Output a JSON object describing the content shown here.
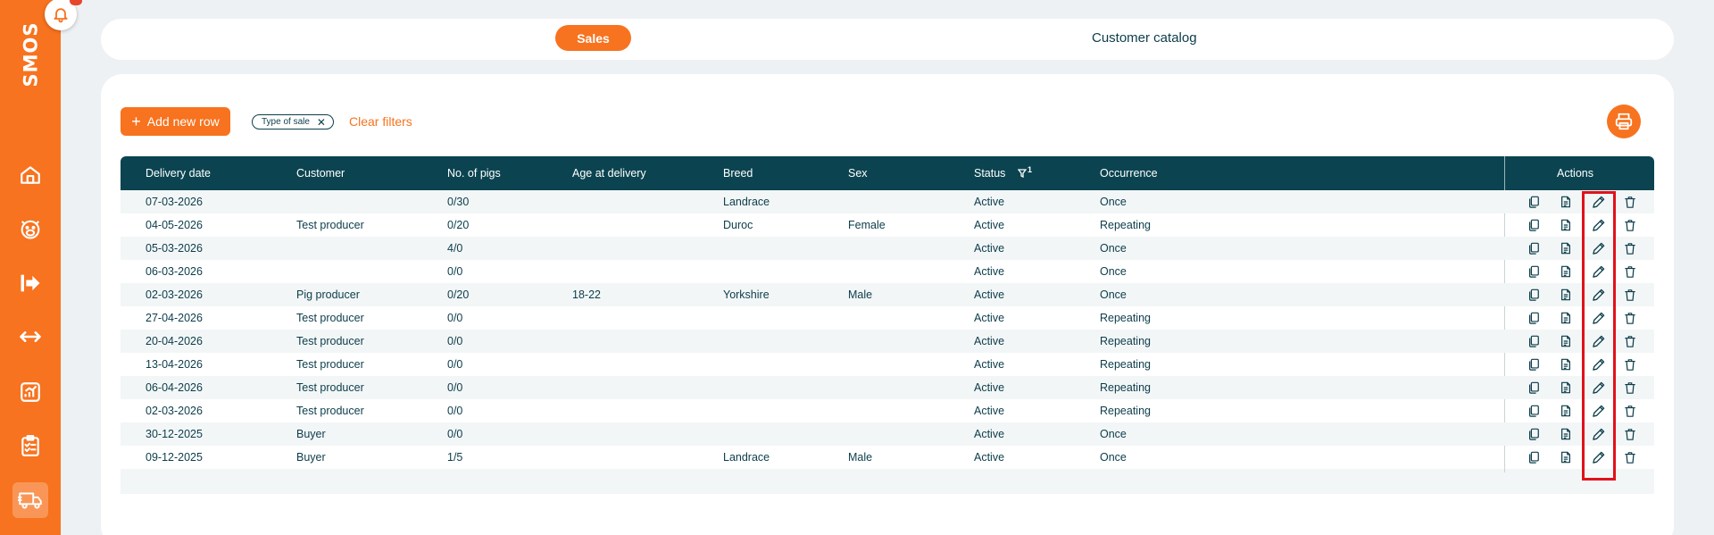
{
  "sidebar": {
    "brand": "SMOS",
    "items": [
      {
        "name": "home-icon"
      },
      {
        "name": "pig-icon"
      },
      {
        "name": "arrow-right-icon"
      },
      {
        "name": "exchange-icon"
      },
      {
        "name": "chart-icon"
      },
      {
        "name": "checklist-icon"
      },
      {
        "name": "truck-icon",
        "active": true
      }
    ]
  },
  "tabs": {
    "sales": "Sales",
    "catalog": "Customer catalog"
  },
  "toolbar": {
    "add_label": "Add new row",
    "filter_chip": "Type of sale",
    "clear_label": "Clear filters"
  },
  "table": {
    "headers": {
      "delivery_date": "Delivery date",
      "customer": "Customer",
      "pigs": "No. of pigs",
      "age": "Age at delivery",
      "breed": "Breed",
      "sex": "Sex",
      "status": "Status",
      "occurrence": "Occurrence",
      "actions": "Actions"
    },
    "status_filter_count": "1",
    "rows": [
      {
        "date": "07-03-2026",
        "customer": "",
        "pigs": "0/30",
        "age": "",
        "breed": "Landrace",
        "sex": "",
        "status": "Active",
        "occurrence": "Once"
      },
      {
        "date": "04-05-2026",
        "customer": "Test producer",
        "pigs": "0/20",
        "age": "",
        "breed": "Duroc",
        "sex": "Female",
        "status": "Active",
        "occurrence": "Repeating"
      },
      {
        "date": "05-03-2026",
        "customer": "",
        "pigs": "4/0",
        "age": "",
        "breed": "",
        "sex": "",
        "status": "Active",
        "occurrence": "Once"
      },
      {
        "date": "06-03-2026",
        "customer": "",
        "pigs": "0/0",
        "age": "",
        "breed": "",
        "sex": "",
        "status": "Active",
        "occurrence": "Once"
      },
      {
        "date": "02-03-2026",
        "customer": "Pig producer",
        "pigs": "0/20",
        "age": "18-22",
        "breed": "Yorkshire",
        "sex": "Male",
        "status": "Active",
        "occurrence": "Once"
      },
      {
        "date": "27-04-2026",
        "customer": "Test producer",
        "pigs": "0/0",
        "age": "",
        "breed": "",
        "sex": "",
        "status": "Active",
        "occurrence": "Repeating"
      },
      {
        "date": "20-04-2026",
        "customer": "Test producer",
        "pigs": "0/0",
        "age": "",
        "breed": "",
        "sex": "",
        "status": "Active",
        "occurrence": "Repeating"
      },
      {
        "date": "13-04-2026",
        "customer": "Test producer",
        "pigs": "0/0",
        "age": "",
        "breed": "",
        "sex": "",
        "status": "Active",
        "occurrence": "Repeating"
      },
      {
        "date": "06-04-2026",
        "customer": "Test producer",
        "pigs": "0/0",
        "age": "",
        "breed": "",
        "sex": "",
        "status": "Active",
        "occurrence": "Repeating"
      },
      {
        "date": "02-03-2026",
        "customer": "Test producer",
        "pigs": "0/0",
        "age": "",
        "breed": "",
        "sex": "",
        "status": "Active",
        "occurrence": "Repeating"
      },
      {
        "date": "30-12-2025",
        "customer": "Buyer",
        "pigs": "0/0",
        "age": "",
        "breed": "",
        "sex": "",
        "status": "Active",
        "occurrence": "Once"
      },
      {
        "date": "09-12-2025",
        "customer": "Buyer",
        "pigs": "1/5",
        "age": "",
        "breed": "Landrace",
        "sex": "Male",
        "status": "Active",
        "occurrence": "Once"
      }
    ],
    "row_actions": [
      "copy-icon",
      "document-icon",
      "edit-icon",
      "trash-icon"
    ]
  },
  "colors": {
    "accent": "#f7731f",
    "header": "#0b4450",
    "text": "#0b3d4a",
    "highlight": "#e0121b"
  }
}
